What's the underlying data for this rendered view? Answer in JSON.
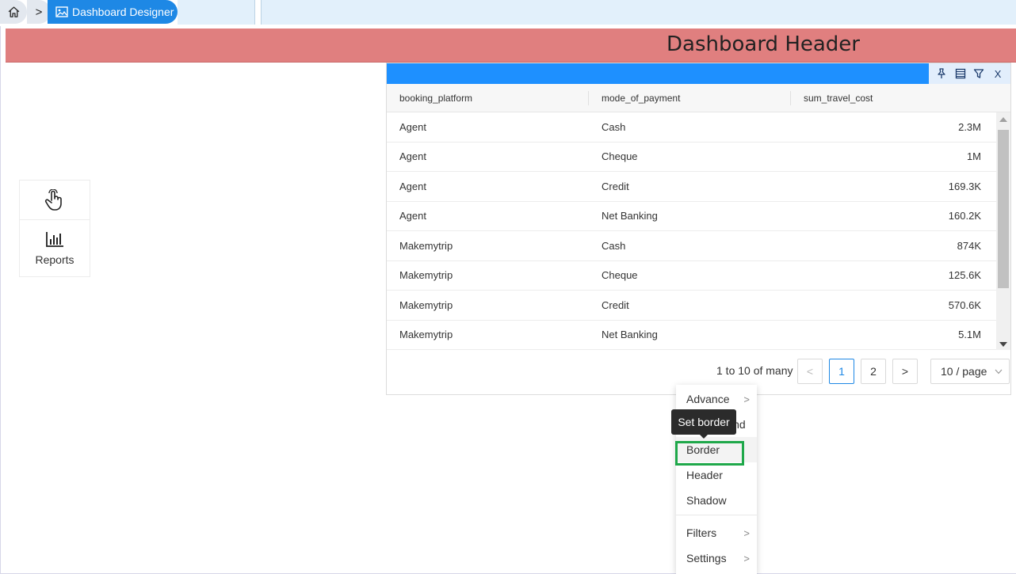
{
  "breadcrumb": {
    "home_icon": "home-icon",
    "separator": ">",
    "active_label": "Dashboard Designer",
    "active_icon": "image-icon"
  },
  "dashboard": {
    "header_title": "Dashboard Header",
    "header_color": "#e07f7f"
  },
  "widgets_panel": {
    "touch_icon": "hand-pointer-icon",
    "reports_icon": "bar-chart-icon",
    "reports_label": "Reports"
  },
  "table_widget": {
    "header_color": "#1e90ff",
    "tools": [
      "pin-icon",
      "table-icon",
      "filter-icon",
      "close-icon"
    ],
    "close_glyph": "X",
    "columns": [
      "booking_platform",
      "mode_of_payment",
      "sum_travel_cost"
    ],
    "rows": [
      [
        "Agent",
        "Cash",
        "2.3M"
      ],
      [
        "Agent",
        "Cheque",
        "1M"
      ],
      [
        "Agent",
        "Credit",
        "169.3K"
      ],
      [
        "Agent",
        "Net Banking",
        "160.2K"
      ],
      [
        "Makemytrip",
        "Cash",
        "874K"
      ],
      [
        "Makemytrip",
        "Cheque",
        "125.6K"
      ],
      [
        "Makemytrip",
        "Credit",
        "570.6K"
      ],
      [
        "Makemytrip",
        "Net Banking",
        "5.1M"
      ]
    ],
    "pagination": {
      "info": "1 to 10 of many",
      "prev": "<",
      "pages": [
        "1",
        "2"
      ],
      "current_page": "1",
      "next": ">",
      "page_size": "10 / page"
    }
  },
  "context_menu": {
    "items": [
      {
        "label": "Advance",
        "has_submenu": true
      },
      {
        "label": "Background",
        "has_submenu": false
      },
      {
        "label": "Border",
        "has_submenu": false
      },
      {
        "label": "Header",
        "has_submenu": false
      },
      {
        "label": "Shadow",
        "has_submenu": false
      },
      {
        "label": "Filters",
        "has_submenu": true
      },
      {
        "label": "Settings",
        "has_submenu": true
      }
    ],
    "submenu_arrow": ">",
    "highlight_color": "#1fa84a"
  },
  "tooltip": {
    "text": "Set border"
  }
}
